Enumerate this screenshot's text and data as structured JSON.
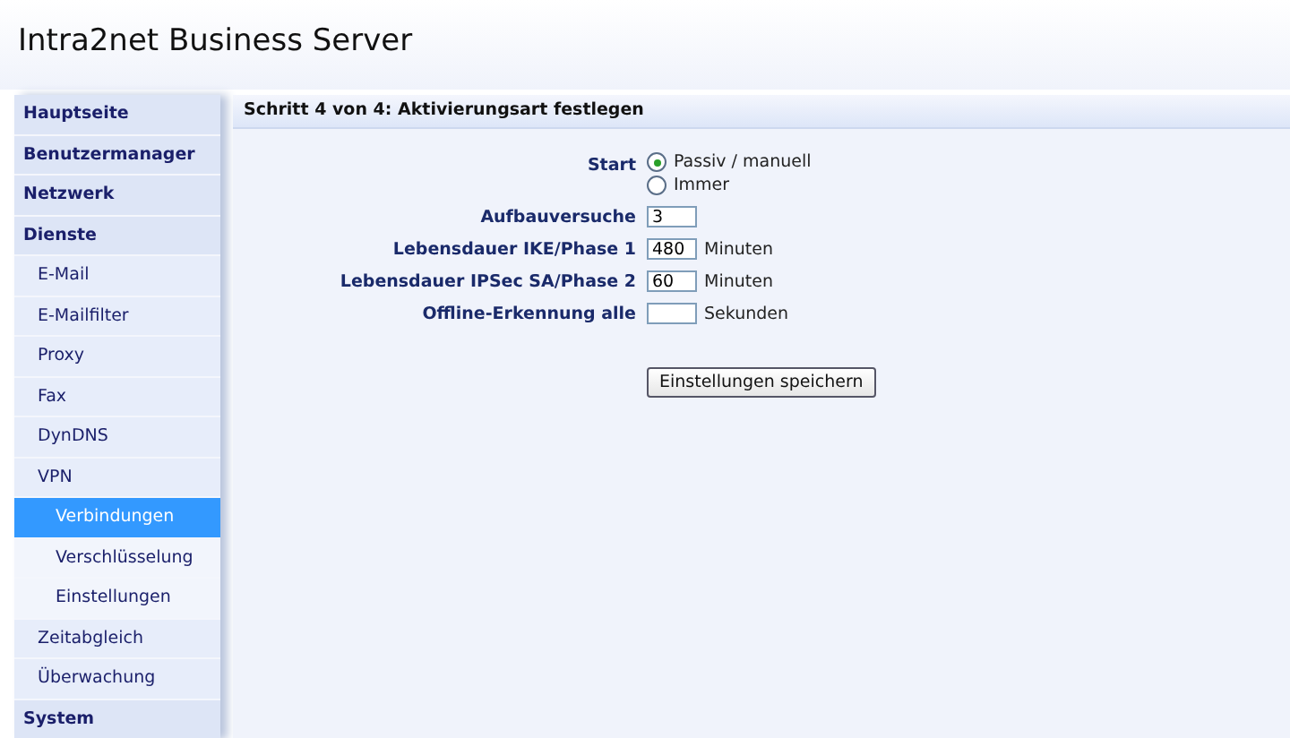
{
  "header": {
    "logo_bold": "Intra2net",
    "logo_rest": "Business Server"
  },
  "sidebar": {
    "items": [
      {
        "label": "Hauptseite",
        "selected": false
      },
      {
        "label": "Benutzermanager",
        "selected": false
      },
      {
        "label": "Netzwerk",
        "selected": false
      },
      {
        "label": "Dienste",
        "selected": false,
        "children": [
          {
            "label": "E-Mail",
            "selected": false
          },
          {
            "label": "E-Mailfilter",
            "selected": false
          },
          {
            "label": "Proxy",
            "selected": false
          },
          {
            "label": "Fax",
            "selected": false
          },
          {
            "label": "DynDNS",
            "selected": false
          },
          {
            "label": "VPN",
            "selected": false,
            "children": [
              {
                "label": "Verbindungen",
                "selected": true
              },
              {
                "label": "Verschlüsselung",
                "selected": false
              },
              {
                "label": "Einstellungen",
                "selected": false
              }
            ]
          },
          {
            "label": "Zeitabgleich",
            "selected": false
          },
          {
            "label": "Überwachung",
            "selected": false
          }
        ]
      },
      {
        "label": "System",
        "selected": false
      }
    ]
  },
  "panel": {
    "title": "Schritt 4 von 4: Aktivierungsart festlegen",
    "fields": [
      {
        "kind": "radio",
        "label": "Start",
        "options": [
          {
            "label": "Passiv / manuell",
            "selected": true
          },
          {
            "label": "Immer",
            "selected": false
          }
        ]
      },
      {
        "kind": "text",
        "label": "Aufbauversuche",
        "value": "3"
      },
      {
        "kind": "text",
        "label": "Lebensdauer IKE/Phase 1",
        "value": "480",
        "unit": "Minuten"
      },
      {
        "kind": "text",
        "label": "Lebensdauer IPSec SA/Phase 2",
        "value": "60",
        "unit": "Minuten"
      },
      {
        "kind": "text",
        "label": "Offline-Erkennung alle",
        "unit": "Sekunden"
      }
    ],
    "button": "Einstellungen speichern"
  }
}
